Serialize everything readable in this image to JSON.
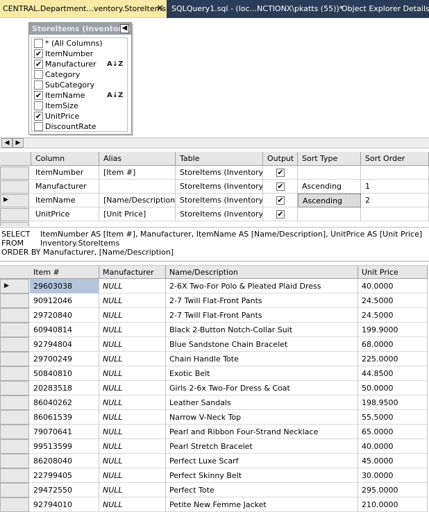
{
  "tabs": [
    {
      "label": "CENTRAL.Department...ventory.StoreItems",
      "close": "✕",
      "active": true
    },
    {
      "label": "SQLQuery1.sql - (loc...NCTIONX\\pkatts (55))*",
      "active": false
    },
    {
      "label": "Object Explorer Details",
      "active": false
    }
  ],
  "diagram": {
    "table_title": "StoreItems (Inventory)",
    "minimize_glyph": "−",
    "columns": [
      {
        "label": "* (All Columns)",
        "checked": false,
        "sort": ""
      },
      {
        "label": "ItemNumber",
        "checked": true,
        "sort": ""
      },
      {
        "label": "Manufacturer",
        "checked": true,
        "sort": "A↓Z"
      },
      {
        "label": "Category",
        "checked": false,
        "sort": ""
      },
      {
        "label": "SubCategory",
        "checked": false,
        "sort": ""
      },
      {
        "label": "ItemName",
        "checked": true,
        "sort": "A↓Z"
      },
      {
        "label": "ItemSize",
        "checked": false,
        "sort": ""
      },
      {
        "label": "UnitPrice",
        "checked": true,
        "sort": ""
      },
      {
        "label": "DiscountRate",
        "checked": false,
        "sort": ""
      }
    ]
  },
  "criteria": {
    "headers": [
      "Column",
      "Alias",
      "Table",
      "Output",
      "Sort Type",
      "Sort Order"
    ],
    "rows": [
      {
        "column": "ItemNumber",
        "alias": "[Item #]",
        "table": "StoreItems (Inventory)",
        "output": true,
        "sort_type": "",
        "sort_order": ""
      },
      {
        "column": "Manufacturer",
        "alias": "",
        "table": "StoreItems (Inventory)",
        "output": true,
        "sort_type": "Ascending",
        "sort_order": "1"
      },
      {
        "column": "ItemName",
        "alias": "[Name/Description]",
        "table": "StoreItems (Inventory)",
        "output": true,
        "sort_type": "Ascending",
        "sort_order": "2",
        "current": true
      },
      {
        "column": "UnitPrice",
        "alias": "[Unit Price]",
        "table": "StoreItems (Inventory)",
        "output": true,
        "sort_type": "",
        "sort_order": ""
      }
    ]
  },
  "sql": {
    "select_kw": "SELECT",
    "select": "ItemNumber AS [Item #], Manufacturer, ItemName AS [Name/Description], UnitPrice AS [Unit Price]",
    "from_kw": "FROM",
    "from": "Inventory.StoreItems",
    "order": "ORDER BY Manufacturer, [Name/Description]"
  },
  "results": {
    "headers": [
      "Item #",
      "Manufacturer",
      "Name/Description",
      "Unit Price"
    ],
    "rows": [
      [
        "29603038",
        "NULL",
        "2-6X Two-For Polo & Pleated Plaid Dress",
        "40.0000"
      ],
      [
        "90912046",
        "NULL",
        "2-7 Twill Flat-Front Pants",
        "24.5000"
      ],
      [
        "29720840",
        "NULL",
        "2-7 Twill Flat-Front Pants",
        "24.5000"
      ],
      [
        "60940814",
        "NULL",
        "Black 2-Button Notch-Collar Suit",
        "199.9000"
      ],
      [
        "92794804",
        "NULL",
        "Blue Sandstone Chain Bracelet",
        "68.0000"
      ],
      [
        "29700249",
        "NULL",
        "Chain Handle Tote",
        "225.0000"
      ],
      [
        "50840810",
        "NULL",
        "Exotic Belt",
        "44.8500"
      ],
      [
        "20283518",
        "NULL",
        "Girls 2-6x Two-For Dress & Coat",
        "50.0000"
      ],
      [
        "86040262",
        "NULL",
        "Leather Sandals",
        "198.9500"
      ],
      [
        "86061539",
        "NULL",
        "Narrow V-Neck Top",
        "55.5000"
      ],
      [
        "79070641",
        "NULL",
        "Pearl and Ribbon Four-Strand Necklace",
        "65.0000"
      ],
      [
        "99513599",
        "NULL",
        "Pearl Stretch Bracelet",
        "40.0000"
      ],
      [
        "86208040",
        "NULL",
        "Perfect Luxe Scarf",
        "45.0000"
      ],
      [
        "22799405",
        "NULL",
        "Perfect Skinny Belt",
        "30.0000"
      ],
      [
        "29472550",
        "NULL",
        "Perfect Tote",
        "295.0000"
      ],
      [
        "92794010",
        "NULL",
        "Petite New Femme Jacket",
        "210.0000"
      ]
    ]
  },
  "glyphs": {
    "check": "✔",
    "row_pointer": "▶",
    "scroll_left": "◀",
    "scroll_right": "▶"
  },
  "colors": {
    "tab_active": "#f8e9a6",
    "tab_strip": "#2b3c59",
    "selected_cell": "#b7c5dc"
  }
}
